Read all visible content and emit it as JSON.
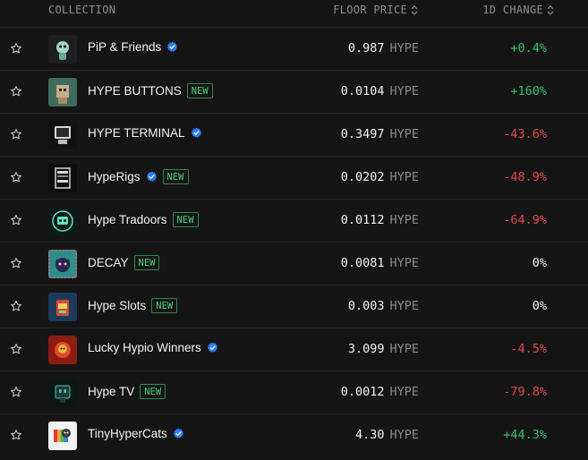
{
  "header": {
    "collection": "COLLECTION",
    "floor_price": "FLOOR PRICE",
    "change_1d": "1D CHANGE"
  },
  "colors": {
    "positive": "#35c46a",
    "negative": "#e5484d",
    "new_badge": "#4fd27a",
    "verified": "#2f7cf6"
  },
  "rows": [
    {
      "name": "PiP & Friends",
      "verified": true,
      "new": false,
      "floor": "0.987",
      "unit": "HYPE",
      "change": "+0.4%",
      "trend": "pos"
    },
    {
      "name": "HYPE BUTTONS",
      "verified": false,
      "new": true,
      "badge": "NEW",
      "floor": "0.0104",
      "unit": "HYPE",
      "change": "+160%",
      "trend": "pos"
    },
    {
      "name": "HYPE TERMINAL",
      "verified": true,
      "new": false,
      "floor": "0.3497",
      "unit": "HYPE",
      "change": "-43.6%",
      "trend": "neg"
    },
    {
      "name": "HypeRigs",
      "verified": true,
      "new": true,
      "badge": "NEW",
      "floor": "0.0202",
      "unit": "HYPE",
      "change": "-48.9%",
      "trend": "neg"
    },
    {
      "name": "Hype Tradoors",
      "verified": false,
      "new": true,
      "badge": "NEW",
      "floor": "0.0112",
      "unit": "HYPE",
      "change": "-64.9%",
      "trend": "neg"
    },
    {
      "name": "DECAY",
      "verified": false,
      "new": true,
      "badge": "NEW",
      "floor": "0.0081",
      "unit": "HYPE",
      "change": "0%",
      "trend": "neu"
    },
    {
      "name": "Hype Slots",
      "verified": false,
      "new": true,
      "badge": "NEW",
      "floor": "0.003",
      "unit": "HYPE",
      "change": "0%",
      "trend": "neu"
    },
    {
      "name": "Lucky Hypio Winners",
      "verified": true,
      "new": false,
      "floor": "3.099",
      "unit": "HYPE",
      "change": "-4.5%",
      "trend": "neg"
    },
    {
      "name": "Hype TV",
      "verified": false,
      "new": true,
      "badge": "NEW",
      "floor": "0.0012",
      "unit": "HYPE",
      "change": "-79.8%",
      "trend": "neg"
    },
    {
      "name": "TinyHyperCats",
      "verified": true,
      "new": false,
      "floor": "4.30",
      "unit": "HYPE",
      "change": "+44.3%",
      "trend": "pos"
    }
  ]
}
